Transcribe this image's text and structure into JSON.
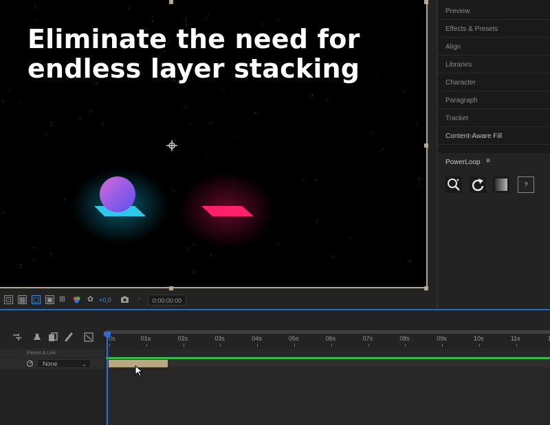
{
  "composition": {
    "headline_line1": "Eliminate the need for",
    "headline_line2": "endless layer stacking",
    "background_color": "#000000",
    "sphere_colors": [
      "#d46ad8",
      "#5a4ff0"
    ],
    "plate_left_color": "#2ec8e8",
    "plate_right_color": "#ff1f6a"
  },
  "viewer_toolbar": {
    "exposure": "+0,0",
    "timecode": "0:00:00:00"
  },
  "right_panel": {
    "items": [
      "Preview",
      "Effects & Presets",
      "Align",
      "Libraries",
      "Character",
      "Paragraph",
      "Tracker",
      "Content-Aware Fill"
    ],
    "powerloop": {
      "title": "PowerLoop",
      "menu_icon": "≡",
      "buttons": [
        "magnify-icon",
        "loop-arrow-icon",
        "gradient-icon",
        "help-icon"
      ],
      "help_label": "?"
    }
  },
  "timeline": {
    "column_header": "Parent & Link",
    "parent_value": "None",
    "ticks": [
      "0s",
      "01s",
      "02s",
      "03s",
      "04s",
      "05s",
      "06s",
      "07s",
      "08s",
      "09s",
      "10s",
      "11s",
      "1"
    ],
    "accent_color": "#2d6fd6",
    "track_color": "#2ec04a",
    "clip_color": "#b9a784"
  }
}
